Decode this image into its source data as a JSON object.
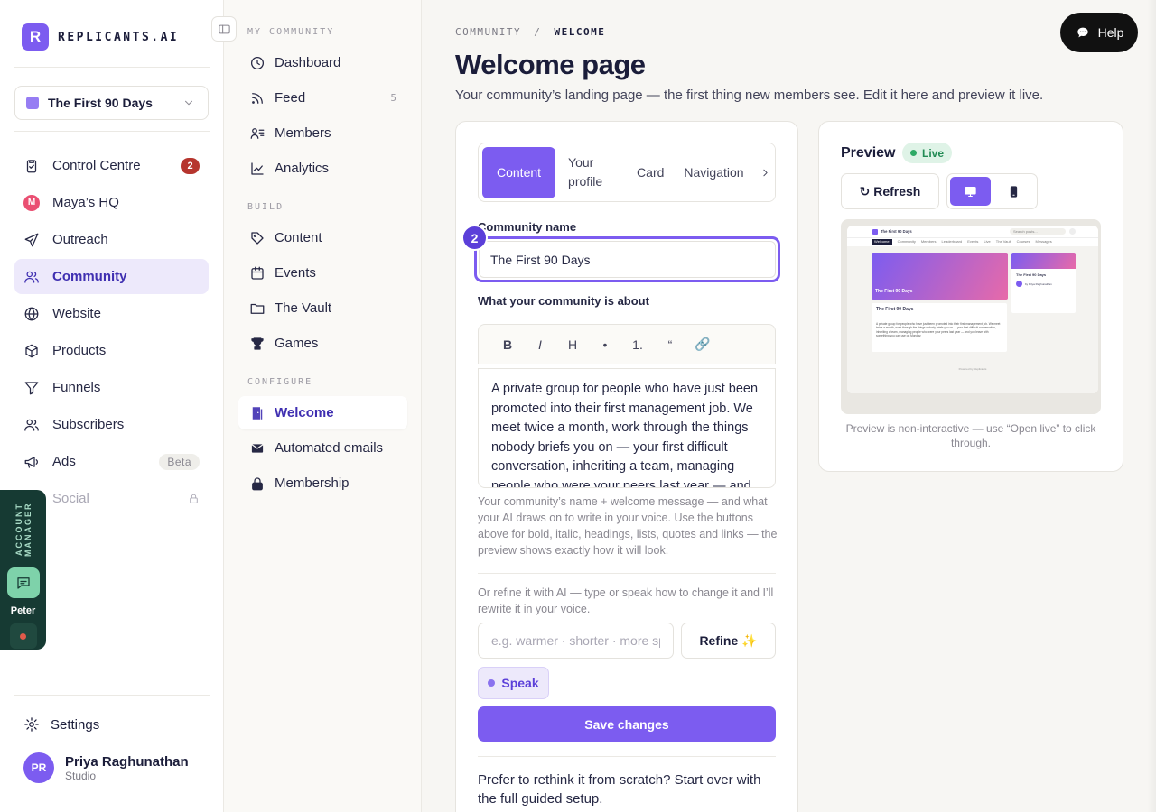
{
  "brand": {
    "logo_letter": "R",
    "name": "REPLICANTS.AI",
    "accent": "#7c5cf0"
  },
  "workspace": {
    "name": "The First 90 Days"
  },
  "sidebar": {
    "items": [
      {
        "label": "Control Centre",
        "icon": "clipboard-icon",
        "badge": "2"
      },
      {
        "label": "Maya’s HQ",
        "icon": "maya-avatar-icon",
        "initial": "M"
      },
      {
        "label": "Outreach",
        "icon": "send-icon"
      },
      {
        "label": "Community",
        "icon": "users-icon",
        "active": true
      },
      {
        "label": "Website",
        "icon": "globe-icon"
      },
      {
        "label": "Products",
        "icon": "box-icon"
      },
      {
        "label": "Funnels",
        "icon": "funnel-icon"
      },
      {
        "label": "Subscribers",
        "icon": "users-icon"
      },
      {
        "label": "Ads",
        "icon": "megaphone-icon",
        "tag": "Beta"
      },
      {
        "label": "Social",
        "icon": "chat-icon",
        "locked": true
      }
    ],
    "settings_label": "Settings",
    "user": {
      "initials": "PR",
      "name": "Priya Raghunathan",
      "plan": "Studio"
    }
  },
  "account_manager": {
    "label": "ACCOUNT MANAGER",
    "name": "Peter"
  },
  "subnav": {
    "section_community": "MY COMMUNITY",
    "section_build": "BUILD",
    "section_configure": "CONFIGURE",
    "community": [
      {
        "label": "Dashboard",
        "icon": "clock-icon"
      },
      {
        "label": "Feed",
        "icon": "rss-icon",
        "count": "5"
      },
      {
        "label": "Members",
        "icon": "members-icon"
      },
      {
        "label": "Analytics",
        "icon": "chart-icon"
      }
    ],
    "build": [
      {
        "label": "Content",
        "icon": "tag-icon"
      },
      {
        "label": "Events",
        "icon": "calendar-icon"
      },
      {
        "label": "The Vault",
        "icon": "folder-icon"
      },
      {
        "label": "Games",
        "icon": "trophy-icon"
      }
    ],
    "configure": [
      {
        "label": "Welcome",
        "icon": "door-icon",
        "active": true
      },
      {
        "label": "Automated emails",
        "icon": "mail-icon"
      },
      {
        "label": "Membership",
        "icon": "lock-icon"
      }
    ]
  },
  "header": {
    "crumb_parent": "COMMUNITY",
    "crumb_sep": "/",
    "crumb_current": "WELCOME",
    "title": "Welcome page",
    "lead": "Your community’s landing page — the first thing new members see. Edit it here and preview it live.",
    "help_label": "Help"
  },
  "editor": {
    "tabs": [
      {
        "label": "Content",
        "active": true
      },
      {
        "label": "Your profile"
      },
      {
        "label": "Card"
      },
      {
        "label": "Navigation"
      }
    ],
    "step_number": "2",
    "name_label": "Community name",
    "name_value": "The First 90 Days",
    "about_label": "What your community is about",
    "format_buttons": [
      "B",
      "I",
      "H",
      "•",
      "1.",
      "“",
      "🔗"
    ],
    "about_text": "A private group for people who have just been promoted into their first management job. We meet twice a month, work through the things nobody briefs you on — your first difficult conversation, inheriting a team, managing people who were your peers last year — and you leave with something you can use on Monday.",
    "hint": "Your community’s name + welcome message — and what your AI draws on to write in your voice. Use the buttons above for bold, italic, headings, lists, quotes and links — the preview shows exactly how it will look.",
    "refine_hint": "Or refine it with AI — type or speak how to change it and I’ll rewrite it in your voice.",
    "refine_placeholder": "e.g. warmer · shorter · more specific",
    "refine_label": "Refine ✨",
    "speak_label": "Speak",
    "save_label": "Save changes",
    "restart_text": "Prefer to rethink it from scratch? Start over with the full guided setup."
  },
  "preview": {
    "title": "Preview",
    "live_label": "Live",
    "refresh_label": "↻ Refresh",
    "note": "Preview is non-interactive — use “Open live” to click through.",
    "mini": {
      "site_name": "The First 90 Days",
      "search": "Search posts...",
      "nav": [
        "Welcome",
        "Community",
        "Members",
        "Leaderboard",
        "Events",
        "Live",
        "The Vault",
        "Courses",
        "Messages"
      ],
      "hero_title": "The First 90 Days",
      "card_title": "The First 90 Days",
      "host": "by Priya Raghunathan",
      "body": "A private group for people who have just been promoted into their first management job. We meet twice a month, work through the things nobody briefs you on — your first difficult conversation, inheriting a team, managing people who were your peers last year — and you leave with something you can use on Monday.",
      "footer": "Powered by Replicants"
    }
  }
}
